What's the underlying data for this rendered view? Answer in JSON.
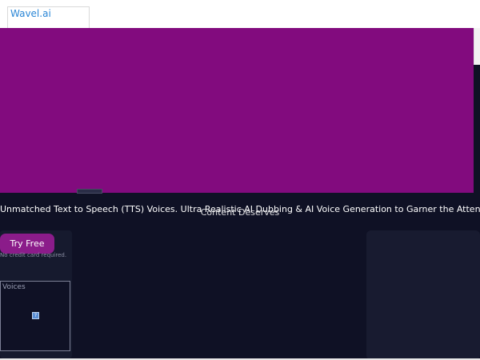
{
  "header": {
    "logo_text": "Wavel.ai"
  },
  "hero": {
    "line1": "Unmatched Text to Speech (TTS) Voices. Ultra Realistic AI Dubbing & AI Voice Generation to Garner the Attention Your",
    "line2": "Content Deserves"
  },
  "cta": {
    "try_label": "Try Free",
    "no_card_text": "No credit card required."
  },
  "voices": {
    "label": "Voices",
    "icon": "image-placeholder-icon"
  },
  "colors": {
    "overlay_purple": "#820b7e",
    "background_dark": "#0f1125",
    "button_purple": "#8b1c8a",
    "link_blue": "#2a86d6"
  }
}
